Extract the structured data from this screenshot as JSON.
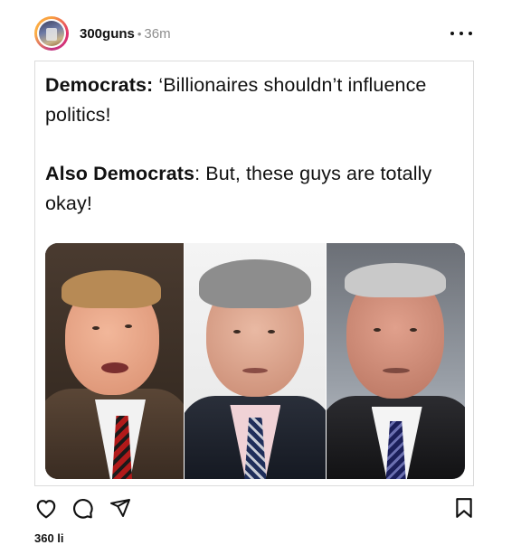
{
  "post": {
    "username": "300guns",
    "separator": "•",
    "time_ago": "36m",
    "text": {
      "line1_label": "Democrats:",
      "line1_text": " ‘Billionaires shouldn’t influence",
      "line2_text": "politics!",
      "line3_label": "Also Democrats",
      "line3_text": ": But, these guys are totally",
      "line4_text": "okay!"
    },
    "likes_partial": "360 li"
  },
  "icons": {
    "more": "more-horizontal-icon",
    "like": "heart-icon",
    "comment": "comment-bubble-icon",
    "share": "paper-plane-icon",
    "save": "bookmark-icon"
  },
  "colors": {
    "text": "#111111",
    "muted": "#8e8e8e",
    "border": "#dbdbdb"
  }
}
